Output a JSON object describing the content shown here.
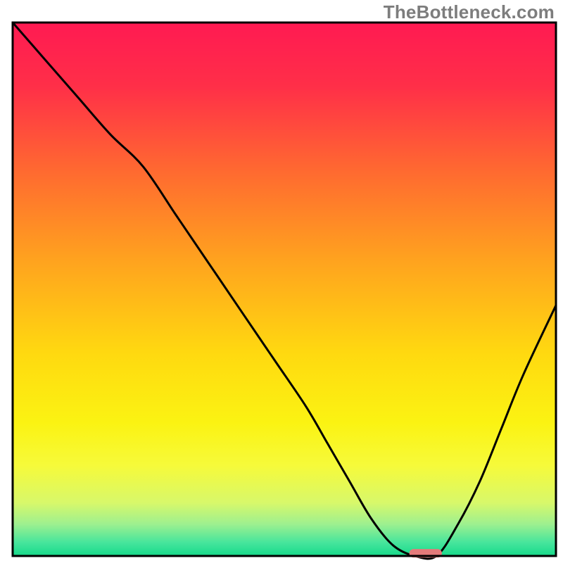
{
  "watermark": "TheBottleneck.com",
  "chart_data": {
    "type": "line",
    "title": "",
    "xlabel": "",
    "ylabel": "",
    "xlim": [
      0,
      100
    ],
    "ylim": [
      0,
      100
    ],
    "grid": false,
    "axes_visible": false,
    "background_gradient": {
      "stops": [
        {
          "offset": 0.0,
          "color": "#ff1a52"
        },
        {
          "offset": 0.12,
          "color": "#ff2f48"
        },
        {
          "offset": 0.28,
          "color": "#ff6a30"
        },
        {
          "offset": 0.45,
          "color": "#ffa41e"
        },
        {
          "offset": 0.62,
          "color": "#ffd910"
        },
        {
          "offset": 0.75,
          "color": "#fbf312"
        },
        {
          "offset": 0.83,
          "color": "#f6fa3a"
        },
        {
          "offset": 0.9,
          "color": "#d8f86a"
        },
        {
          "offset": 0.94,
          "color": "#9ef08f"
        },
        {
          "offset": 0.975,
          "color": "#46e59c"
        },
        {
          "offset": 1.0,
          "color": "#16d98a"
        }
      ]
    },
    "series": [
      {
        "name": "bottleneck-curve",
        "color": "#000000",
        "x": [
          0,
          6,
          12,
          18,
          24,
          30,
          36,
          42,
          48,
          54,
          58,
          62,
          66,
          70,
          74,
          78,
          82,
          86,
          90,
          94,
          100
        ],
        "y": [
          100,
          93,
          86,
          79,
          73,
          64,
          55,
          46,
          37,
          28,
          21,
          14,
          7,
          2,
          0,
          0,
          6,
          14,
          24,
          34,
          47
        ]
      }
    ],
    "marker": {
      "name": "sweet-spot",
      "shape": "rounded-rect",
      "color": "#e47a7a",
      "x": 76,
      "y": 0.5,
      "width": 6.0,
      "height": 1.6
    }
  }
}
